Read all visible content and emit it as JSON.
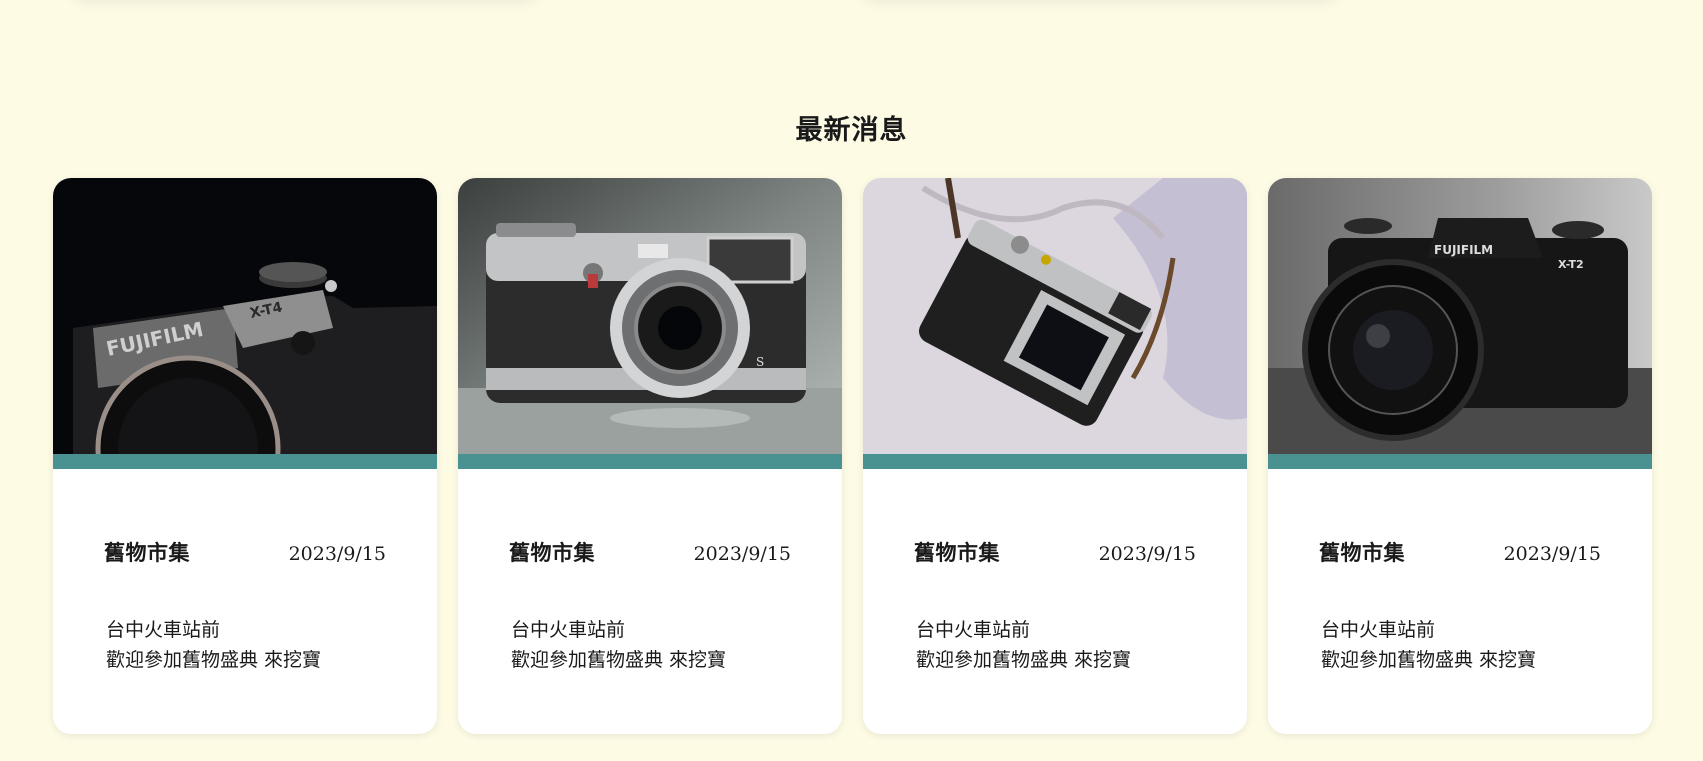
{
  "section": {
    "title": "最新消息"
  },
  "news": [
    {
      "image": "fujifilm-xt4-camera-photo",
      "title": "舊物市集",
      "date": "2023/9/15",
      "line1": "台中火車站前",
      "line2": "歡迎參加舊物盛典 來挖寶"
    },
    {
      "image": "fujifilm-x100-camera-photo",
      "title": "舊物市集",
      "date": "2023/9/15",
      "line1": "台中火車站前",
      "line2": "歡迎參加舊物盛典 來挖寶"
    },
    {
      "image": "fujifilm-x100v-on-fabric-photo",
      "title": "舊物市集",
      "date": "2023/9/15",
      "line1": "台中火車站前",
      "line2": "歡迎參加舊物盛典 來挖寶"
    },
    {
      "image": "fujifilm-xt2-camera-photo",
      "title": "舊物市集",
      "date": "2023/9/15",
      "line1": "台中火車站前",
      "line2": "歡迎參加舊物盛典 來挖寶"
    }
  ],
  "photo_labels": {
    "brand_xt4": "FUJIFILM",
    "model_xt4": "X-T4",
    "brand_xt2": "FUJIFILM",
    "model_xt2": "X-T2"
  },
  "colors": {
    "background": "#fdfbe4",
    "card": "#ffffff",
    "accent_stripe": "#4a9291"
  }
}
